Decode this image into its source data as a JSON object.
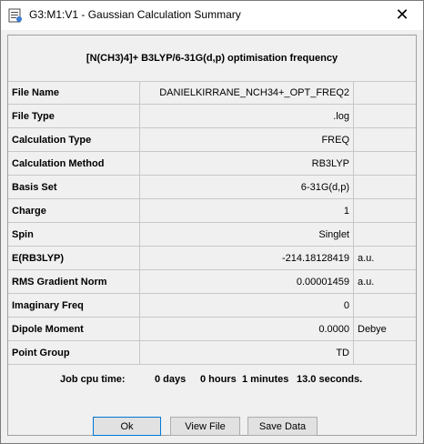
{
  "window": {
    "title": "G3:M1:V1 - Gaussian Calculation Summary",
    "close_glyph": "✕",
    "icon": "gaussview-app-icon"
  },
  "summary": {
    "heading": "[N(CH3)4]+ B3LYP/6-31G(d,p) optimisation frequency",
    "rows": [
      {
        "label": "File Name",
        "value": "DANIELKIRRANE_NCH34+_OPT_FREQ2",
        "unit": ""
      },
      {
        "label": "File Type",
        "value": ".log",
        "unit": ""
      },
      {
        "label": "Calculation Type",
        "value": "FREQ",
        "unit": ""
      },
      {
        "label": "Calculation Method",
        "value": "RB3LYP",
        "unit": ""
      },
      {
        "label": "Basis Set",
        "value": "6-31G(d,p)",
        "unit": ""
      },
      {
        "label": "Charge",
        "value": "1",
        "unit": ""
      },
      {
        "label": "Spin",
        "value": "Singlet",
        "unit": ""
      },
      {
        "label": "E(RB3LYP)",
        "value": "-214.18128419",
        "unit": "a.u."
      },
      {
        "label": "RMS Gradient Norm",
        "value": "0.00001459",
        "unit": "a.u."
      },
      {
        "label": "Imaginary Freq",
        "value": "0",
        "unit": ""
      },
      {
        "label": "Dipole Moment",
        "value": "0.0000",
        "unit": "Debye"
      },
      {
        "label": "Point Group",
        "value": "TD",
        "unit": ""
      }
    ],
    "cpu_time": {
      "label": "Job cpu time:",
      "days": "0 days",
      "hours": "0 hours",
      "minutes": "1 minutes",
      "seconds": "13.0 seconds."
    }
  },
  "buttons": {
    "ok": "Ok",
    "view_file": "View File",
    "save_data": "Save Data"
  }
}
